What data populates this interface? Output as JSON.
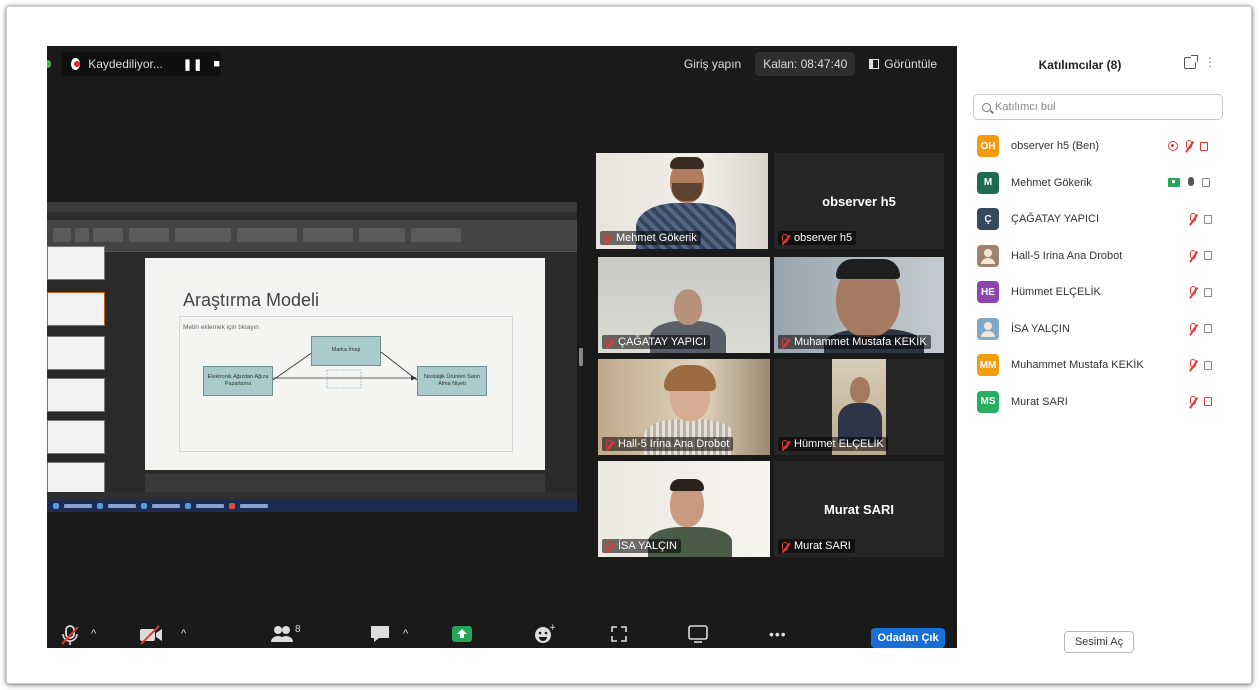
{
  "recording": {
    "label": "Kaydediliyor...",
    "pause_glyph": "❚❚",
    "stop_glyph": "■"
  },
  "topbar": {
    "sign_in": "Giriş yapın",
    "time_left": "Kalan: 08:47:40",
    "view": "Görüntüle"
  },
  "slide": {
    "title": "Araştırma Modeli",
    "subtitle": "Metin eklemek için tıklayın",
    "node_center": "Marka İmajı",
    "node_left": "Elektronik Ağızdan Ağıza Pazarlama",
    "node_right": "Nostaljik Ürünleri Satın Alma Niyeti"
  },
  "tiles": [
    {
      "name": "Mehmet Gökerik",
      "video": true,
      "speaking": true
    },
    {
      "name": "observer h5",
      "video": false
    },
    {
      "name": "ÇAĞATAY YAPICI",
      "video": true
    },
    {
      "name": "Muhammet Mustafa KEKİK",
      "video": true
    },
    {
      "name": "Hall-5 Irina Ana Drobot",
      "video": true
    },
    {
      "name": "Hümmet ELÇELİK",
      "video": true
    },
    {
      "name": "İSA YALÇIN",
      "video": true
    },
    {
      "name": "Murat SARI",
      "video": false
    }
  ],
  "toolbar": {
    "participant_count": "8",
    "leave": "Odadan Çık"
  },
  "panel": {
    "title": "Katılımcılar (8)",
    "more_glyph": "⋮",
    "search_placeholder": "Katılımcı bul",
    "unmute_button": "Sesimi Aç",
    "participants": [
      {
        "initials": "OH",
        "name": "observer h5 (Ben)",
        "color": "#f39c12",
        "icons": [
          "rec",
          "mic-off",
          "cam-off"
        ]
      },
      {
        "initials": "M",
        "name": "Mehmet Gökerik",
        "color": "#1e6b52",
        "icons": [
          "share",
          "mic-on",
          "cam"
        ]
      },
      {
        "initials": "Ç",
        "name": "ÇAĞATAY YAPICI",
        "color": "#34495e",
        "icons": [
          "mic-off",
          "cam"
        ]
      },
      {
        "initials": "",
        "name": "Hall-5 Irina Ana Drobot",
        "color": "#a0826d",
        "icons": [
          "mic-off",
          "cam"
        ]
      },
      {
        "initials": "HE",
        "name": "Hümmet ELÇELİK",
        "color": "#8e44ad",
        "icons": [
          "mic-off",
          "cam"
        ]
      },
      {
        "initials": "",
        "name": "İSA YALÇIN",
        "color": "#7fa8c9",
        "icons": [
          "mic-off",
          "cam"
        ]
      },
      {
        "initials": "MM",
        "name": "Muhammet Mustafa KEKİK",
        "color": "#f39c12",
        "icons": [
          "mic-off",
          "cam"
        ]
      },
      {
        "initials": "MS",
        "name": "Murat SARI",
        "color": "#27ae60",
        "icons": [
          "mic-off",
          "cam-off"
        ]
      }
    ]
  }
}
